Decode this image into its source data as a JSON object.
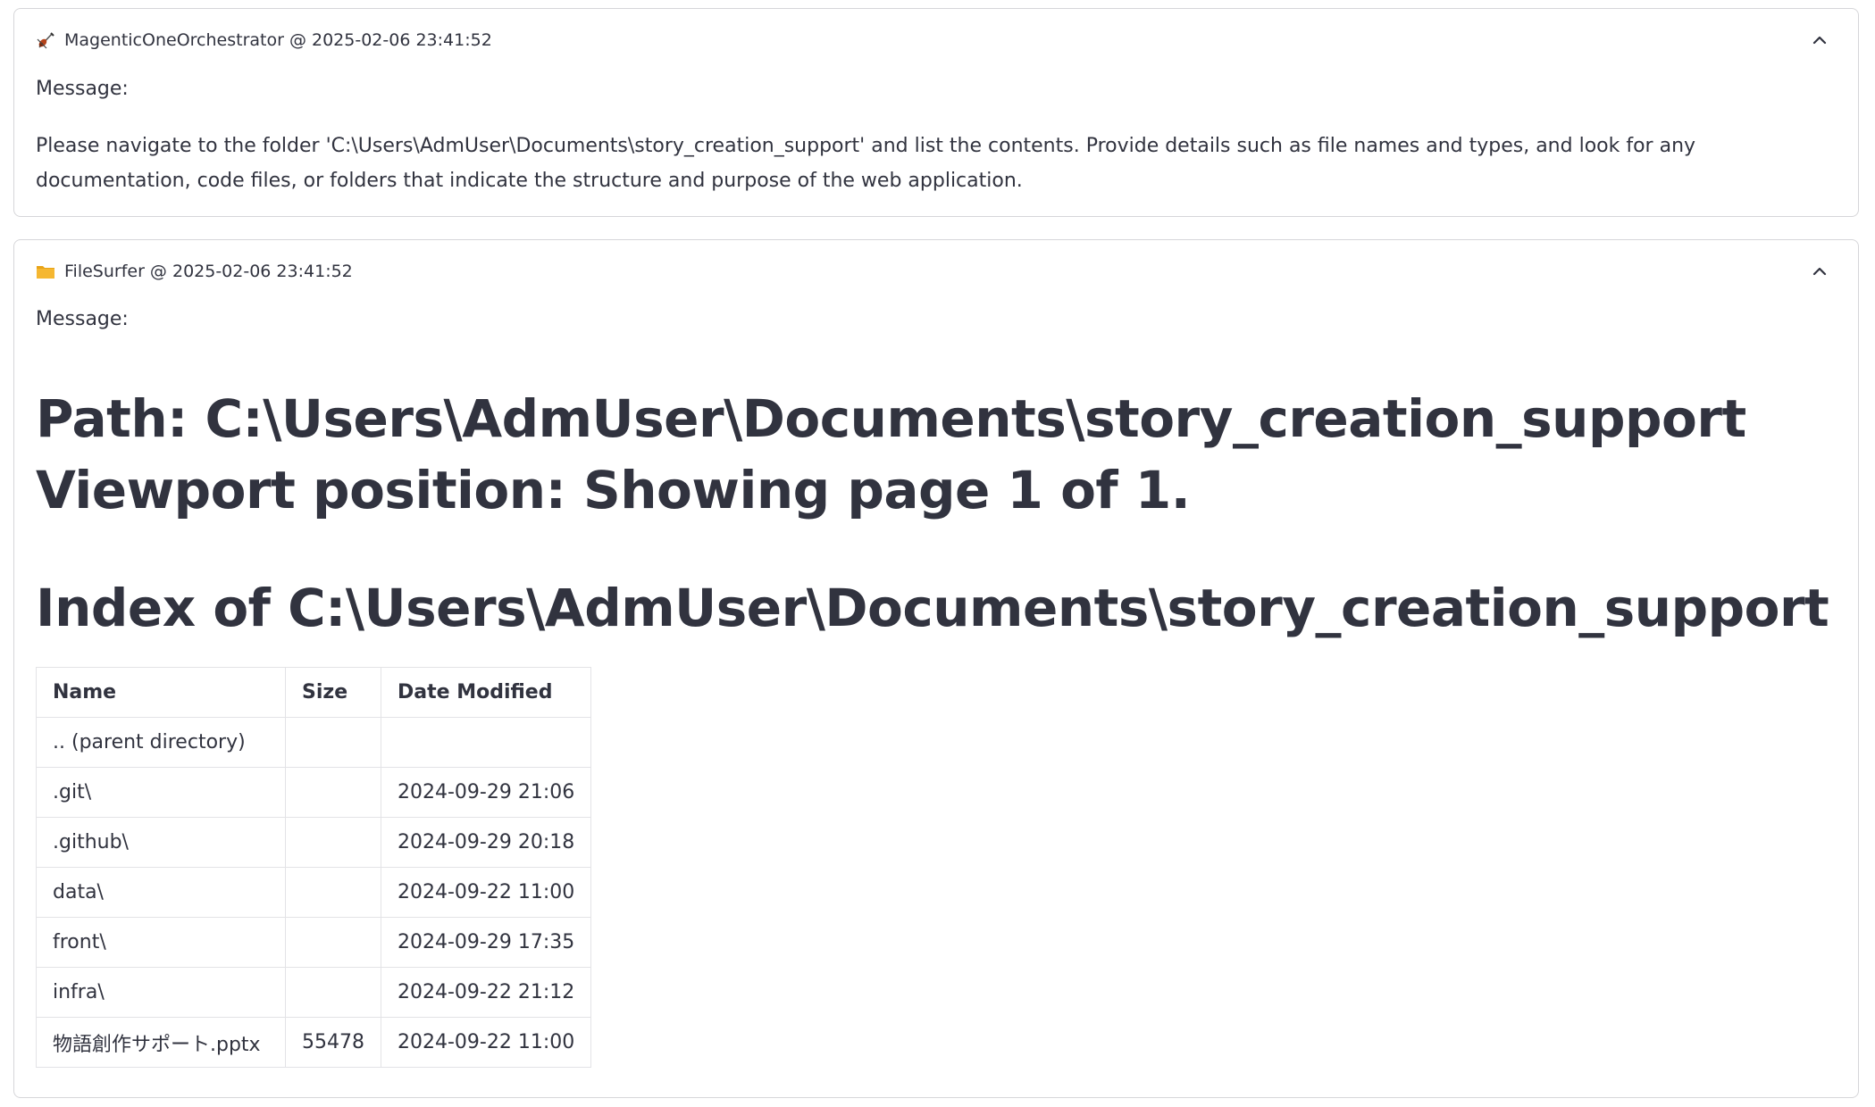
{
  "messages": [
    {
      "icon": "violin-icon",
      "header": "MagenticOneOrchestrator @ 2025-02-06 23:41:52",
      "message_label": "Message:",
      "body": "Please navigate to the folder 'C:\\Users\\AdmUser\\Documents\\story_creation_support' and list the contents. Provide details such as file names and types, and look for any documentation, code files, or folders that indicate the structure and purpose of the web application."
    },
    {
      "icon": "folder-icon",
      "header": "FileSurfer @ 2025-02-06 23:41:52",
      "message_label": "Message:",
      "path_heading": "Path: C:\\Users\\AdmUser\\Documents\\story_creation_support",
      "viewport_heading": "Viewport position: Showing page 1 of 1.",
      "index_heading": "Index of C:\\Users\\AdmUser\\Documents\\story_creation_support",
      "table": {
        "headers": [
          "Name",
          "Size",
          "Date Modified"
        ],
        "rows": [
          [
            ".. (parent directory)",
            "",
            ""
          ],
          [
            ".git\\",
            "",
            "2024-09-29 21:06"
          ],
          [
            ".github\\",
            "",
            "2024-09-29 20:18"
          ],
          [
            "data\\",
            "",
            "2024-09-22 11:00"
          ],
          [
            "front\\",
            "",
            "2024-09-29 17:35"
          ],
          [
            "infra\\",
            "",
            "2024-09-22 21:12"
          ],
          [
            "物語創作サポート.pptx",
            "55478",
            "2024-09-22 11:00"
          ]
        ]
      }
    }
  ],
  "colors": {
    "text": "#31333f",
    "border": "#d6d6d9",
    "table_border": "#e3e3e6",
    "folder": "#f5b731"
  }
}
